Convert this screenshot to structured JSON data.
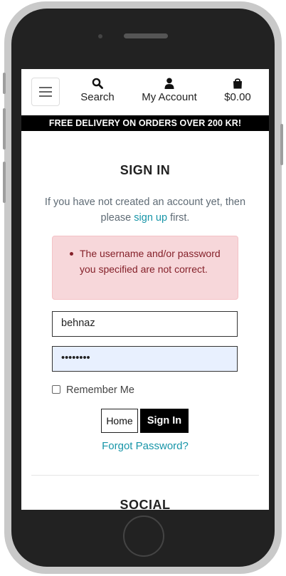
{
  "nav": {
    "menu_icon": "hamburger-icon",
    "search_label": "Search",
    "search_icon": "search-icon",
    "account_label": "My Account",
    "account_icon": "user-icon",
    "cart_amount": "$0.00",
    "cart_icon": "shopping-bag-icon"
  },
  "banner": {
    "text": "FREE DELIVERY ON ORDERS OVER 200 KR!"
  },
  "signin": {
    "title": "SIGN IN",
    "intro_before": "If you have not created an account yet, then please ",
    "intro_link": "sign up",
    "intro_after": " first.",
    "error_message": "The username and/or password you specified are not correct.",
    "username_value": "behnaz",
    "password_mask": "••••••••",
    "remember_label": "Remember Me",
    "home_button": "Home",
    "signin_button": "Sign In",
    "forgot_link": "Forgot Password?"
  },
  "footer": {
    "social_heading": "SOCIAL"
  },
  "colors": {
    "accent_link": "#1795a8",
    "error_bg": "#f7d7da",
    "error_text": "#842029",
    "autofill_bg": "#e8f0fe",
    "banner_bg": "#000000"
  }
}
